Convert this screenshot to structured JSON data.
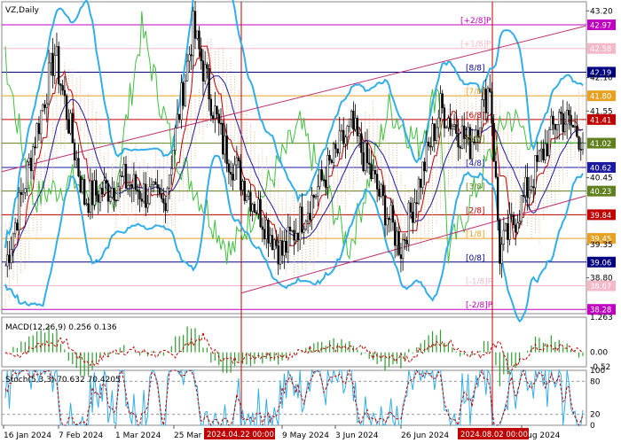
{
  "chart_data": {
    "type": "candlestick",
    "title": "VZ,Daily",
    "symbol": "VZ",
    "timeframe": "Daily",
    "ylim": [
      38.21,
      43.35
    ],
    "y_ticks": [
      43.2,
      42.1,
      41.55,
      40.45,
      39.35,
      38.8
    ],
    "date_labels": [
      "16 Jan 2024",
      "7 Feb 2024",
      "1 Mar 2024",
      "25 Mar 2024",
      "9 May 2024",
      "3 Jun 2024",
      "26 Jun 2024",
      "Aug 2024"
    ],
    "highlight_dates": [
      "2024.04.22 00:00",
      "2024.08.02 00:00"
    ],
    "price_levels": [
      {
        "price": 42.97,
        "label": "42.97",
        "color": "#c000c0",
        "murrey": "[+2/8]P"
      },
      {
        "price": 42.58,
        "label": "42.58",
        "color": "#f4b8c8",
        "murrey": "[+1/8]P"
      },
      {
        "price": 42.19,
        "label": "42.19",
        "color": "#000080",
        "murrey": "[8/8]"
      },
      {
        "price": 41.8,
        "label": "41.80",
        "color": "#e8a020",
        "murrey": "[7/8]"
      },
      {
        "price": 41.41,
        "label": "41.41",
        "color": "#c00000",
        "murrey": "[6/8]"
      },
      {
        "price": 41.02,
        "label": "41.02",
        "color": "#608020",
        "murrey": "[5/8]"
      },
      {
        "price": 40.62,
        "label": "40.62",
        "color": "#1a1aa0",
        "murrey": "[4/8]"
      },
      {
        "price": 40.23,
        "label": "40.23",
        "color": "#608020",
        "murrey": "[3/8]"
      },
      {
        "price": 39.84,
        "label": "39.84",
        "color": "#c00000",
        "murrey": "[2/8]"
      },
      {
        "price": 39.45,
        "label": "39.45",
        "color": "#e8a020",
        "murrey": "[1/8]"
      },
      {
        "price": 39.06,
        "label": "39.06",
        "color": "#000080",
        "murrey": "[0/8]"
      },
      {
        "price": 38.67,
        "label": "38.67",
        "color": "#f4b8c8",
        "murrey": "[-1/8]P"
      },
      {
        "price": 38.28,
        "label": "38.28",
        "color": "#c000c0",
        "murrey": "[-2/8]P"
      }
    ],
    "macd": {
      "label": "MACD(12,26,9)",
      "macd_value": 0.256,
      "signal_value": 0.136,
      "ticks": [
        "1.263",
        "0.00",
        "-0.52"
      ]
    },
    "stochastic": {
      "label": "Stoch(5,3,3)",
      "k_value": 70.632,
      "d_value": 70.4205,
      "ticks": [
        "100",
        "80",
        "20",
        "0"
      ]
    }
  }
}
